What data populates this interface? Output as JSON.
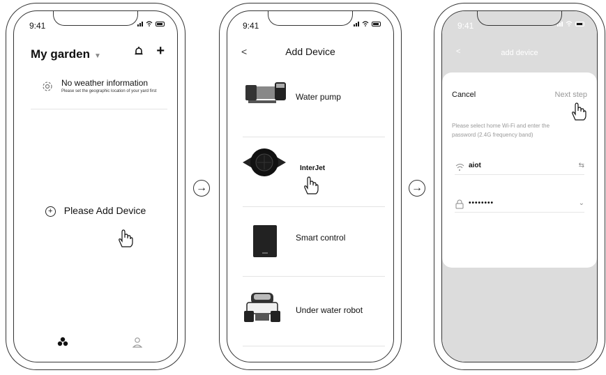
{
  "phone1": {
    "time": "9:41",
    "title": "My garden",
    "caret": "▼",
    "bell_icon": "alarm-icon",
    "plus_icon": "+",
    "weather": {
      "title": "No weather information",
      "subtitle": "Please set the geographic location of your yard first"
    },
    "add_device_label": "Please Add Device"
  },
  "phone2": {
    "time": "9:41",
    "back": "<",
    "title": "Add Device",
    "devices": [
      {
        "label": "Water pump"
      },
      {
        "label": "InterJet"
      },
      {
        "label": "Smart control"
      },
      {
        "label": "Under water robot"
      }
    ]
  },
  "phone3": {
    "time": "9:41",
    "back": "<",
    "title": "add device",
    "cancel": "Cancel",
    "next": "Next step",
    "hint": "Please select home Wi-Fi and enter the password (2.4G frequency band)",
    "wifi_name": "aiot",
    "wifi_trailing": "⇆",
    "password": "••••••••",
    "password_trailing": "⌄"
  },
  "arrows": [
    "→",
    "→"
  ]
}
